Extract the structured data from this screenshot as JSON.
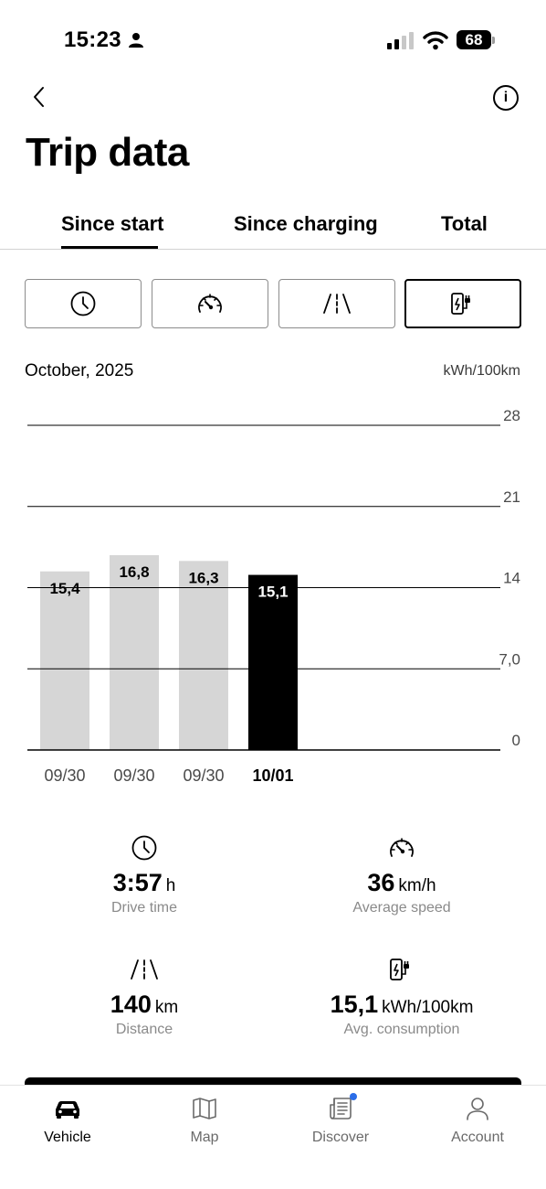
{
  "status_bar": {
    "time": "15:23",
    "battery": "68",
    "signal_bars": 2,
    "signal_total": 4
  },
  "header": {
    "title": "Trip data",
    "info_label": "i"
  },
  "tabs": [
    {
      "label": "Since start",
      "active": true
    },
    {
      "label": "Since charging",
      "active": false
    },
    {
      "label": "Total",
      "active": false
    }
  ],
  "metric_buttons": [
    {
      "icon": "clock-icon",
      "selected": false
    },
    {
      "icon": "speedometer-icon",
      "selected": false
    },
    {
      "icon": "road-icon",
      "selected": false
    },
    {
      "icon": "charging-station-icon",
      "selected": true
    }
  ],
  "chart_data": {
    "type": "bar",
    "title": "October, 2025",
    "ylabel": "kWh/100km",
    "xlabel": "",
    "categories": [
      "09/30",
      "09/30",
      "09/30",
      "10/01"
    ],
    "values": [
      15.4,
      16.8,
      16.3,
      15.1
    ],
    "value_labels": [
      "15,4",
      "16,8",
      "16,3",
      "15,1"
    ],
    "highlight_index": 3,
    "ylim": [
      0,
      28
    ],
    "yticks": [
      0,
      7,
      14,
      21,
      28
    ],
    "ytick_labels": [
      "0",
      "7,0",
      "14",
      "21",
      "28"
    ],
    "grid": true,
    "colors": {
      "bar": "#d6d6d6",
      "highlight": "#000000",
      "grid": "#000000"
    }
  },
  "stats": [
    {
      "icon": "clock-icon",
      "value": "3:57",
      "unit": "h",
      "label": "Drive time"
    },
    {
      "icon": "speedometer-icon",
      "value": "36",
      "unit": "km/h",
      "label": "Average speed"
    },
    {
      "icon": "road-icon",
      "value": "140",
      "unit": "km",
      "label": "Distance"
    },
    {
      "icon": "charging-station-icon",
      "value": "15,1",
      "unit": "kWh/100km",
      "label": "Avg. consumption"
    }
  ],
  "bottom_nav": [
    {
      "label": "Vehicle",
      "icon": "car-icon",
      "active": true
    },
    {
      "label": "Map",
      "icon": "map-icon",
      "active": false
    },
    {
      "label": "Discover",
      "icon": "newspaper-icon",
      "active": false,
      "notification": true
    },
    {
      "label": "Account",
      "icon": "user-icon",
      "active": false
    }
  ],
  "colors": {
    "accent": "#000000",
    "muted_text": "#8a8a8a",
    "notification": "#2b6de8"
  }
}
